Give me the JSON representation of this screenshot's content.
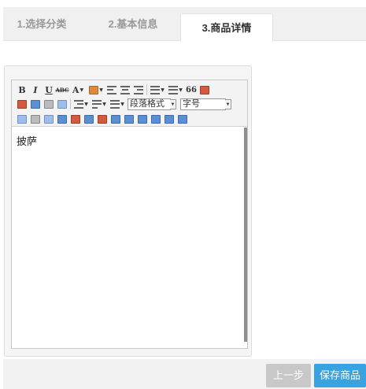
{
  "tabs": [
    {
      "label": "1.选择分类",
      "active": false
    },
    {
      "label": "2.基本信息",
      "active": false
    },
    {
      "label": "3.商品详情",
      "active": true
    }
  ],
  "toolbar": {
    "bold": "B",
    "italic": "I",
    "underline": "U",
    "strike": "ABC",
    "fontcolor": "A",
    "quote": "66",
    "paragraph_format": "段落格式",
    "font_size": "字号"
  },
  "editor": {
    "content": "披萨"
  },
  "buttons": {
    "prev": "上一步",
    "save": "保存商品"
  },
  "colors": {
    "save": "#38a3e0",
    "prev": "#c8c8c8",
    "tab_active_text": "#333333",
    "tab_text": "#999999"
  }
}
